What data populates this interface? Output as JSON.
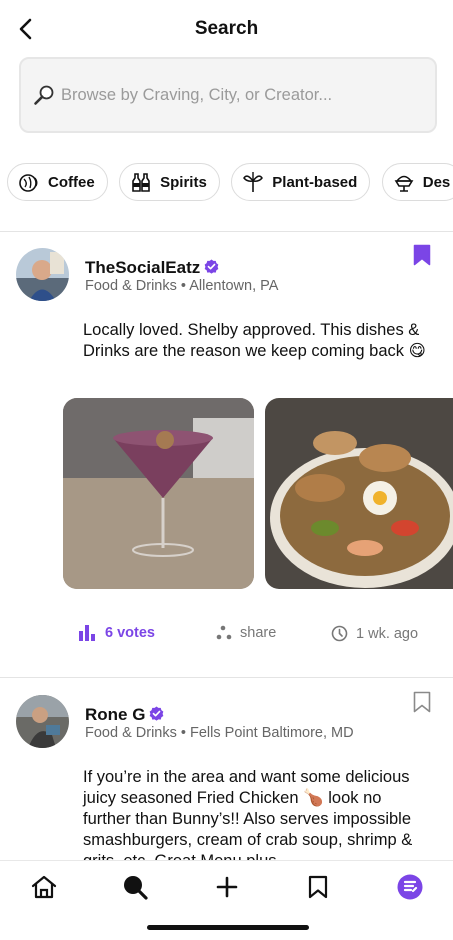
{
  "header": {
    "title": "Search",
    "back_icon": "chevron-left-icon"
  },
  "search": {
    "placeholder": "Browse by Craving, City, or Creator...",
    "value": "",
    "icon": "search-icon"
  },
  "categories": [
    {
      "label": "Coffee",
      "icon": "coffee-icon"
    },
    {
      "label": "Spirits",
      "icon": "bottles-icon"
    },
    {
      "label": "Plant-based",
      "icon": "plant-icon"
    },
    {
      "label": "Des",
      "icon": "dessert-icon"
    }
  ],
  "posts": [
    {
      "author": "TheSocialEatz",
      "verified": true,
      "category": "Food & Drinks",
      "location": "Allentown, PA",
      "bookmarked": true,
      "text": "Locally loved. Shelby approved. This dishes & Drinks are the reason we keep coming back 😋",
      "votes": "6 votes",
      "share": "share",
      "time": "1 wk. ago"
    },
    {
      "author": "Rone G",
      "verified": true,
      "category": "Food & Drinks",
      "location": "Fells Point Baltimore, MD",
      "bookmarked": false,
      "text": "If you’re in the area and want some delicious juicy seasoned Fried Chicken 🍗 look no further than Bunny’s!! Also serves impossible smashburgers, cream of crab soup, shrimp & grits, etc. Great Menu plus"
    }
  ],
  "nav": [
    {
      "name": "home",
      "icon": "home-icon"
    },
    {
      "name": "search",
      "icon": "search-icon"
    },
    {
      "name": "add",
      "icon": "plus-icon"
    },
    {
      "name": "saved",
      "icon": "bookmark-icon"
    },
    {
      "name": "profile",
      "icon": "app-logo-icon"
    }
  ],
  "colors": {
    "accent": "#7b45e6",
    "divider": "#e4e4e4",
    "muted": "#777777"
  }
}
